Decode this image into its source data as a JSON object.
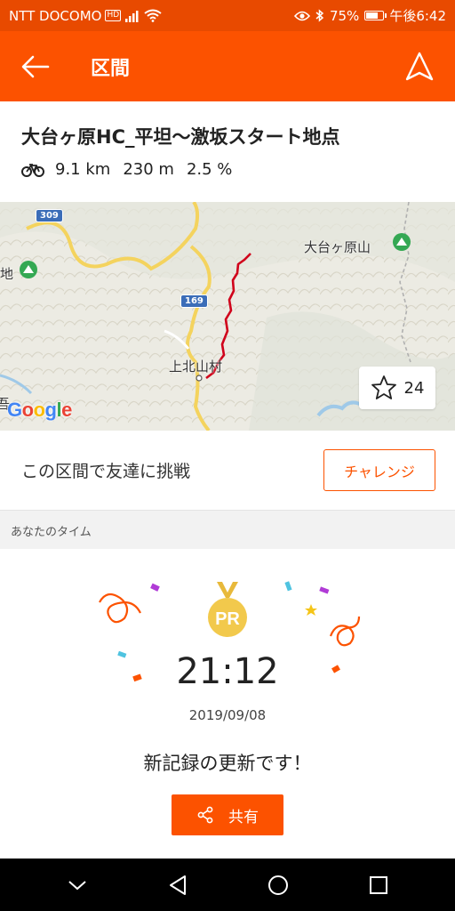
{
  "status_bar": {
    "carrier": "NTT DOCOMO",
    "hd_badge": "HD",
    "battery": "75%",
    "battery_level": 0.75,
    "time": "午後6:42"
  },
  "app_bar": {
    "title": "区間"
  },
  "segment": {
    "name": "大台ヶ原HC_平坦〜激坂スタート地点",
    "sport_icon": "bike-icon",
    "distance": "9.1 km",
    "elevation": "230 m",
    "grade": "2.5 %"
  },
  "map": {
    "labels": {
      "peak_name": "大台ヶ原山",
      "village": "上北山村",
      "left_edge": "地",
      "bottom_left_fragment": "吾",
      "route_309": "309",
      "route_169": "169"
    },
    "google_logo": "Google",
    "star_count": "24",
    "route_color": "#d0021b"
  },
  "challenge": {
    "text": "この区間で友達に挑戦",
    "button_label": "チャレンジ"
  },
  "your_time": {
    "section_label": "あなたのタイム",
    "badge": "PR",
    "time": "21:12",
    "date": "2019/09/08",
    "message": "新記録の更新です！",
    "share_label": "共有"
  },
  "colors": {
    "brand_orange": "#fc5200",
    "status_bar": "#e84a00"
  }
}
